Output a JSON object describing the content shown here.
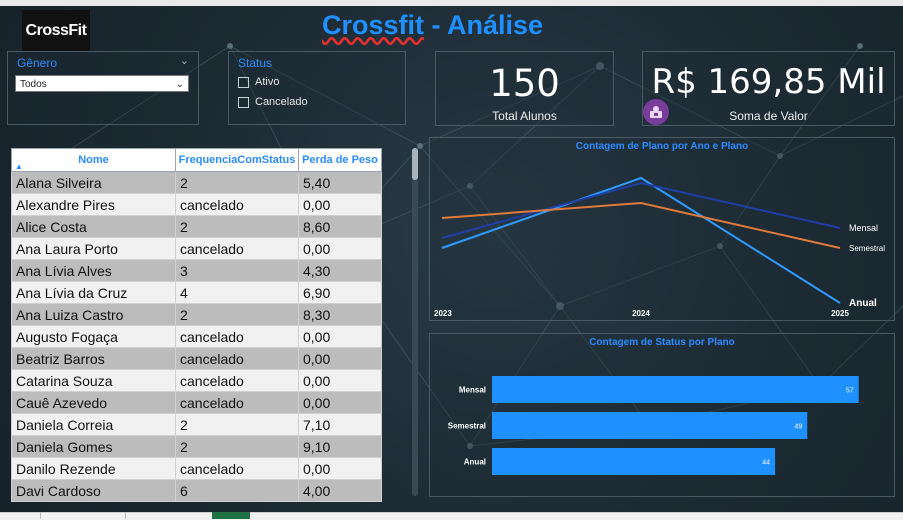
{
  "header": {
    "logo_text": "CrossFit",
    "title_part1": "Crossfit",
    "title_part2": " - Análise"
  },
  "slicer_genero": {
    "title": "Gênero",
    "selected": "Todos"
  },
  "slicer_status": {
    "title": "Status",
    "options": [
      "Ativo",
      "Cancelado"
    ]
  },
  "kpi_alunos": {
    "value": "150",
    "label": "Total Alunos"
  },
  "kpi_valor": {
    "value": "R$ 169,85 Mil",
    "label": "Soma de Valor",
    "icon": "money-bag-icon"
  },
  "table": {
    "columns": [
      "Nome",
      "FrequenciaComStatus",
      "Perda de Peso"
    ],
    "rows": [
      [
        "Alana Silveira",
        "2",
        "5,40"
      ],
      [
        "Alexandre Pires",
        "cancelado",
        "0,00"
      ],
      [
        "Alice Costa",
        "2",
        "8,60"
      ],
      [
        "Ana Laura Porto",
        "cancelado",
        "0,00"
      ],
      [
        "Ana Lívia Alves",
        "3",
        "4,30"
      ],
      [
        "Ana Lívia da Cruz",
        "4",
        "6,90"
      ],
      [
        "Ana Luiza Castro",
        "2",
        "8,30"
      ],
      [
        "Augusto Fogaça",
        "cancelado",
        "0,00"
      ],
      [
        "Beatriz Barros",
        "cancelado",
        "0,00"
      ],
      [
        "Catarina Souza",
        "cancelado",
        "0,00"
      ],
      [
        "Cauê Azevedo",
        "cancelado",
        "0,00"
      ],
      [
        "Daniela Correia",
        "2",
        "7,10"
      ],
      [
        "Daniela Gomes",
        "2",
        "9,10"
      ],
      [
        "Danilo Rezende",
        "cancelado",
        "0,00"
      ],
      [
        "Davi Cardoso",
        "6",
        "4,00"
      ]
    ]
  },
  "colors": {
    "accent": "#2b8cff",
    "bar": "#1e90ff",
    "anual": "#2f9bff",
    "mensal": "#1f3fa8",
    "semestral": "#e07a3a"
  },
  "chart_data": [
    {
      "type": "line",
      "title": "Contagem de Plano por Ano e Plano",
      "x": [
        "2023",
        "2024",
        "2025"
      ],
      "series": [
        {
          "name": "Anual",
          "values": [
            8,
            22,
            -3
          ]
        },
        {
          "name": "Mensal",
          "values": [
            10,
            21,
            12
          ]
        },
        {
          "name": "Semestral",
          "values": [
            14,
            17,
            8
          ]
        }
      ],
      "ylim": [
        -3,
        24
      ],
      "grid": false,
      "legend": "end-of-line labels"
    },
    {
      "type": "bar",
      "title": "Contagem de Status por Plano",
      "categories": [
        "Mensal",
        "Semestral",
        "Anual"
      ],
      "values": [
        57,
        49,
        44
      ],
      "xlim": [
        0,
        60
      ],
      "grid": false
    }
  ]
}
